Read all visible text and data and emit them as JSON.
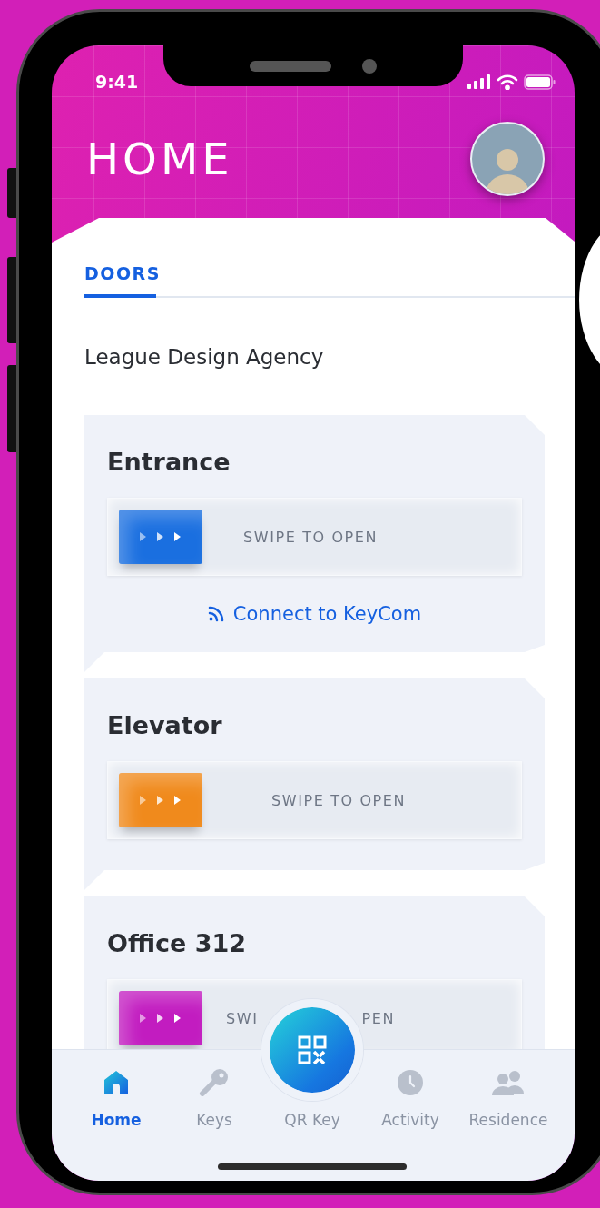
{
  "status_bar": {
    "time": "9:41"
  },
  "header": {
    "title": "HOME"
  },
  "tabs": [
    {
      "label": "DOORS",
      "selected": true
    }
  ],
  "location": "League Design Agency",
  "doors": [
    {
      "name": "Entrance",
      "action": "SWIPE TO OPEN",
      "color": "#1a6fe0",
      "link": "Connect to KeyCom"
    },
    {
      "name": "Elevator",
      "action": "SWIPE TO OPEN",
      "color": "#f08a1c"
    },
    {
      "name": "Office 312",
      "action_parts": [
        "SWI",
        "PEN"
      ],
      "color": "#c21cc0"
    }
  ],
  "nav": [
    {
      "label": "Home",
      "kind": "home",
      "selected": true
    },
    {
      "label": "Keys",
      "kind": "keys",
      "selected": false
    },
    {
      "label": "QR Key",
      "kind": "qr",
      "selected": false
    },
    {
      "label": "Activity",
      "kind": "activity",
      "selected": false
    },
    {
      "label": "Residence",
      "kind": "residence",
      "selected": false
    }
  ]
}
